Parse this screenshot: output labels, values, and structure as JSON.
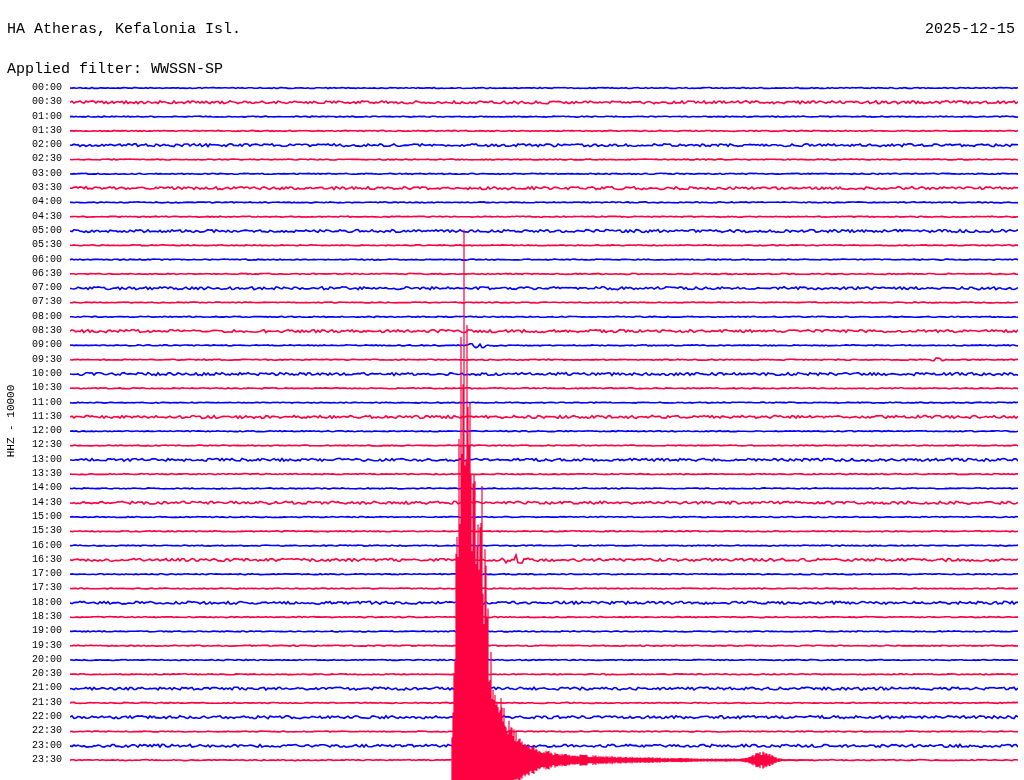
{
  "station": "HA Atheras, Kefalonia Isl.",
  "date": "2025-12-15",
  "filter": "Applied filter: WWSSN-SP",
  "channel_label": "HHZ - 10000",
  "rows": [
    {
      "time": "00:00",
      "color": "#0000ff"
    },
    {
      "time": "00:30",
      "color": "#ff0040"
    },
    {
      "time": "01:00",
      "color": "#0000ff"
    },
    {
      "time": "01:30",
      "color": "#ff0040"
    },
    {
      "time": "02:00",
      "color": "#0000ff"
    },
    {
      "time": "02:30",
      "color": "#ff0040"
    },
    {
      "time": "03:00",
      "color": "#0000ff"
    },
    {
      "time": "03:30",
      "color": "#ff0040"
    },
    {
      "time": "04:00",
      "color": "#0000ff"
    },
    {
      "time": "04:30",
      "color": "#ff0040"
    },
    {
      "time": "05:00",
      "color": "#0000ff"
    },
    {
      "time": "05:30",
      "color": "#ff0040"
    },
    {
      "time": "06:00",
      "color": "#0000ff"
    },
    {
      "time": "06:30",
      "color": "#ff0040"
    },
    {
      "time": "07:00",
      "color": "#0000ff"
    },
    {
      "time": "07:30",
      "color": "#ff0040"
    },
    {
      "time": "08:00",
      "color": "#0000ff"
    },
    {
      "time": "08:30",
      "color": "#ff0040"
    },
    {
      "time": "09:00",
      "color": "#0000ff"
    },
    {
      "time": "09:30",
      "color": "#ff0040"
    },
    {
      "time": "10:00",
      "color": "#0000ff"
    },
    {
      "time": "10:30",
      "color": "#ff0040"
    },
    {
      "time": "11:00",
      "color": "#0000ff"
    },
    {
      "time": "11:30",
      "color": "#ff0040"
    },
    {
      "time": "12:00",
      "color": "#0000ff"
    },
    {
      "time": "12:30",
      "color": "#ff0040"
    },
    {
      "time": "13:00",
      "color": "#0000ff"
    },
    {
      "time": "13:30",
      "color": "#ff0040"
    },
    {
      "time": "14:00",
      "color": "#0000ff"
    },
    {
      "time": "14:30",
      "color": "#ff0040"
    },
    {
      "time": "15:00",
      "color": "#0000ff"
    },
    {
      "time": "15:30",
      "color": "#ff0040"
    },
    {
      "time": "16:00",
      "color": "#0000ff"
    },
    {
      "time": "16:30",
      "color": "#ff0040"
    },
    {
      "time": "17:00",
      "color": "#0000ff"
    },
    {
      "time": "17:30",
      "color": "#ff0040"
    },
    {
      "time": "18:00",
      "color": "#0000ff"
    },
    {
      "time": "18:30",
      "color": "#ff0040"
    },
    {
      "time": "19:00",
      "color": "#0000ff"
    },
    {
      "time": "19:30",
      "color": "#ff0040"
    },
    {
      "time": "20:00",
      "color": "#0000ff"
    },
    {
      "time": "20:30",
      "color": "#ff0040"
    },
    {
      "time": "21:00",
      "color": "#0000ff"
    },
    {
      "time": "21:30",
      "color": "#ff0040"
    },
    {
      "time": "22:00",
      "color": "#0000ff"
    },
    {
      "time": "22:30",
      "color": "#ff0040"
    },
    {
      "time": "23:00",
      "color": "#0000ff"
    },
    {
      "time": "23:30",
      "color": "#ff0040"
    }
  ]
}
